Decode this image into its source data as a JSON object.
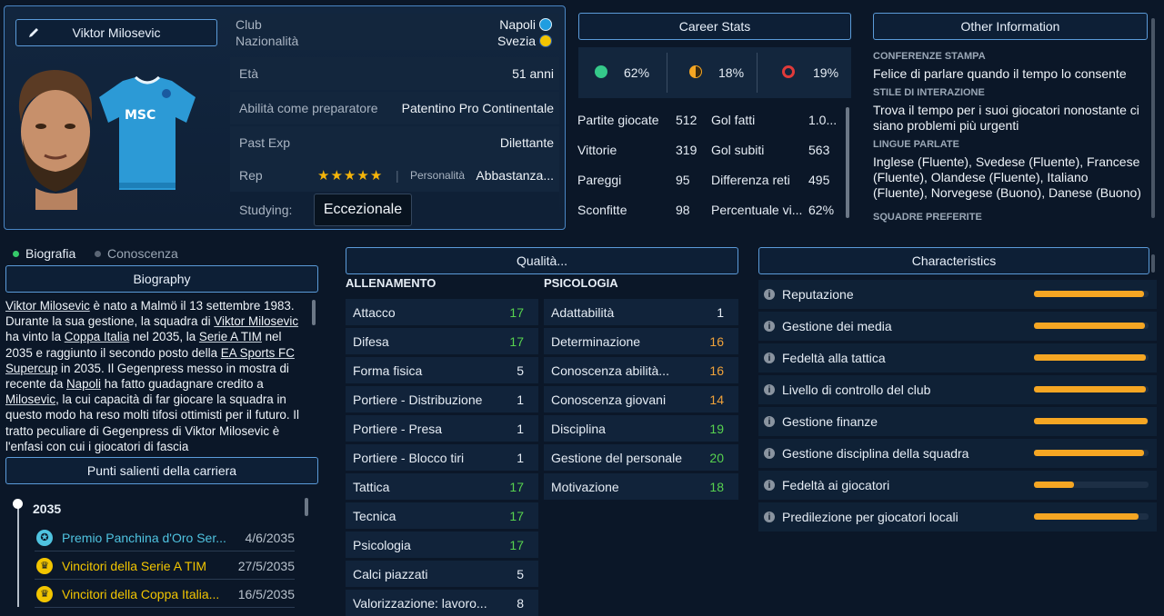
{
  "player": {
    "name": "Viktor Milosevic",
    "club_label": "Club",
    "club": "Napoli",
    "nationality_label": "Nazionalità",
    "nationality": "Svezia",
    "age_label": "Età",
    "age": "51 anni",
    "coaching_label": "Abilità come preparatore",
    "coaching": "Patentino Pro Continentale",
    "past_exp_label": "Past Exp",
    "past_exp": "Dilettante",
    "rep_label": "Rep",
    "rep_stars": 5,
    "personality_label": "Personalità",
    "personality": "Abbastanza...",
    "studying_label": "Studying:",
    "studying": "Eccezionale",
    "shirt_text": "MSC",
    "colors": {
      "club": "#1f9de0",
      "nation": "#f3c400"
    }
  },
  "career_stats": {
    "title": "Career Stats",
    "win_pct": "62%",
    "draw_pct": "18%",
    "loss_pct": "19%",
    "rows": [
      {
        "l1": "Partite giocate",
        "v1": "512",
        "l2": "Gol fatti",
        "v2": "1.0..."
      },
      {
        "l1": "Vittorie",
        "v1": "319",
        "l2": "Gol subiti",
        "v2": "563"
      },
      {
        "l1": "Pareggi",
        "v1": "95",
        "l2": "Differenza reti",
        "v2": "495"
      },
      {
        "l1": "Sconfitte",
        "v1": "98",
        "l2": "Percentuale vi...",
        "v2": "62%"
      }
    ]
  },
  "other_info": {
    "title": "Other Information",
    "press_label": "CONFERENZE STAMPA",
    "press": "Felice di parlare quando il tempo lo consente",
    "style_label": "STILE DI INTERAZIONE",
    "style": "Trova il tempo per i suoi giocatori nonostante ci siano problemi più urgenti",
    "lang_label": "LINGUE PARLATE",
    "languages": "Inglese (Fluente), Svedese (Fluente), Francese (Fluente), Olandese (Fluente), Italiano (Fluente), Norvegese (Buono), Danese (Buono)",
    "teams_label": "SQUADRE PREFERITE"
  },
  "tabs": {
    "bio": "Biografia",
    "knowledge": "Conoscenza"
  },
  "biography": {
    "title": "Biography",
    "text_1": "Viktor Milosevic",
    "text_2": " è nato a Malmö il 13 settembre 1983. Durante la sua gestione, la squadra di ",
    "text_3": "Viktor Milosevic",
    "text_4": " ha vinto la ",
    "text_5": "Coppa Italia",
    "text_6": " nel 2035, la ",
    "text_7": "Serie A TIM",
    "text_8": " nel 2035 e raggiunto il secondo posto della ",
    "text_9": "EA Sports FC Supercup",
    "text_10": " in 2035. Il Gegenpress messo in mostra di recente da ",
    "text_11": "Napoli",
    "text_12": " ha fatto guadagnare credito a ",
    "text_13": "Milosevic",
    "text_14": ", la cui capacità di far giocare la squadra in questo modo ha reso molti tifosi ottimisti per il futuro. Il tratto peculiare di Gegenpress di Viktor Milosevic è l'enfasi con cui i giocatori di fascia"
  },
  "highlights": {
    "title": "Punti salienti della carriera",
    "year": "2035",
    "items": [
      {
        "label": "Premio Panchina d'Oro Ser...",
        "date": "4/6/2035",
        "color": "#4fc3e0"
      },
      {
        "label": "Vincitori della Serie A TIM",
        "date": "27/5/2035",
        "color": "#f2c500"
      },
      {
        "label": "Vincitori della Coppa Italia...",
        "date": "16/5/2035",
        "color": "#f2c500"
      }
    ]
  },
  "qualities": {
    "title": "Qualità...",
    "training_header": "ALLENAMENTO",
    "psych_header": "PSICOLOGIA",
    "training": [
      {
        "label": "Attacco",
        "value": 17
      },
      {
        "label": "Difesa",
        "value": 17
      },
      {
        "label": "Forma fisica",
        "value": 5
      },
      {
        "label": "Portiere - Distribuzione",
        "value": 1
      },
      {
        "label": "Portiere - Presa",
        "value": 1
      },
      {
        "label": "Portiere - Blocco tiri",
        "value": 1
      },
      {
        "label": "Tattica",
        "value": 17
      },
      {
        "label": "Tecnica",
        "value": 17
      },
      {
        "label": "Psicologia",
        "value": 17
      },
      {
        "label": "Calci piazzati",
        "value": 5
      },
      {
        "label": "Valorizzazione: lavoro...",
        "value": 8
      }
    ],
    "psychology": [
      {
        "label": "Adattabilità",
        "value": 1
      },
      {
        "label": "Determinazione",
        "value": 16
      },
      {
        "label": "Conoscenza abilità...",
        "value": 16
      },
      {
        "label": "Conoscenza giovani",
        "value": 14
      },
      {
        "label": "Disciplina",
        "value": 19
      },
      {
        "label": "Gestione del personale",
        "value": 20
      },
      {
        "label": "Motivazione",
        "value": 18
      }
    ]
  },
  "characteristics": {
    "title": "Characteristics",
    "items": [
      {
        "label": "Reputazione",
        "level": 0.96
      },
      {
        "label": "Gestione dei media",
        "level": 0.97
      },
      {
        "label": "Fedeltà alla tattica",
        "level": 0.98
      },
      {
        "label": "Livello di controllo del club",
        "level": 0.98
      },
      {
        "label": "Gestione finanze",
        "level": 0.99
      },
      {
        "label": "Gestione disciplina della squadra",
        "level": 0.96
      },
      {
        "label": "Fedeltà ai giocatori",
        "level": 0.35
      },
      {
        "label": "Predilezione per giocatori locali",
        "level": 0.91
      }
    ]
  }
}
